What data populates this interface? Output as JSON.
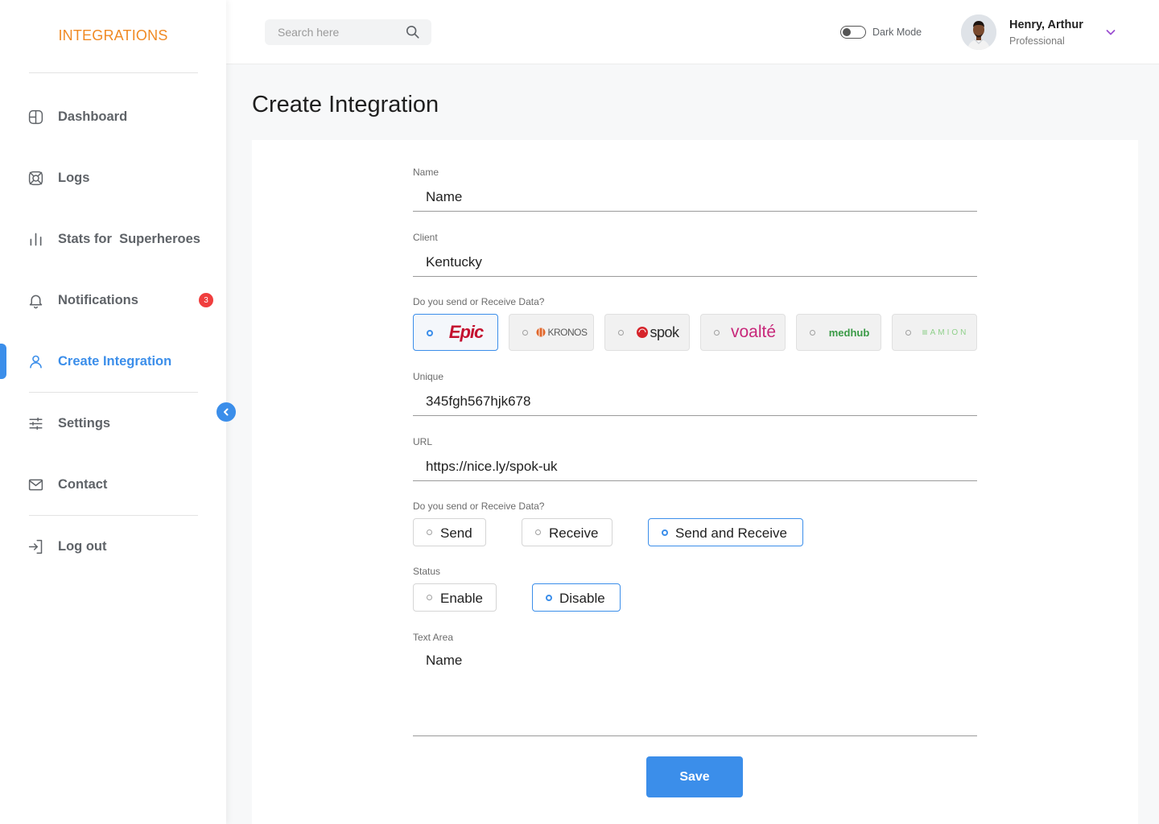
{
  "brand": "INTEGRATIONS",
  "sidebar": {
    "items": [
      {
        "label": "Dashboard",
        "icon": "dashboard-icon"
      },
      {
        "label": "Logs",
        "icon": "logs-icon"
      },
      {
        "label": "Stats for  Superheroes",
        "icon": "stats-icon"
      },
      {
        "label": "Notifications",
        "icon": "bell-icon",
        "badge": "3"
      },
      {
        "label": "Create Integration",
        "icon": "user-icon",
        "active": true
      },
      {
        "label": "Settings",
        "icon": "sliders-icon"
      },
      {
        "label": "Contact",
        "icon": "mail-icon"
      },
      {
        "label": "Log out",
        "icon": "logout-icon"
      }
    ]
  },
  "header": {
    "search_placeholder": "Search here",
    "dark_mode_label": "Dark Mode",
    "user_name": "Henry, Arthur",
    "user_role": "Professional"
  },
  "page_title": "Create Integration",
  "form": {
    "name_label": "Name",
    "name_value": "Name",
    "client_label": "Client",
    "client_value": "Kentucky",
    "vendor_question": "Do you send or Receive Data?",
    "vendors": [
      {
        "label": "Epic",
        "selected": true
      },
      {
        "label": "KRONOS",
        "selected": false
      },
      {
        "label": "spok",
        "selected": false
      },
      {
        "label": "voalté",
        "selected": false
      },
      {
        "label": "medhub",
        "selected": false
      },
      {
        "label": "AMION",
        "selected": false
      }
    ],
    "unique_label": "Unique",
    "unique_value": "345fgh567hjk678",
    "url_label": "URL",
    "url_value": "https://nice.ly/spok-uk",
    "direction_question": "Do you send or Receive Data?",
    "direction_options": [
      {
        "label": "Send",
        "selected": false
      },
      {
        "label": "Receive",
        "selected": false
      },
      {
        "label": "Send and Receive",
        "selected": true
      }
    ],
    "status_label": "Status",
    "status_options": [
      {
        "label": "Enable",
        "selected": false
      },
      {
        "label": "Disable",
        "selected": true
      }
    ],
    "textarea_label": "Text Area",
    "textarea_value": "Name",
    "save_label": "Save"
  },
  "colors": {
    "accent": "#3b8eea",
    "brand": "#f08a24",
    "badge": "#f03e3e"
  }
}
